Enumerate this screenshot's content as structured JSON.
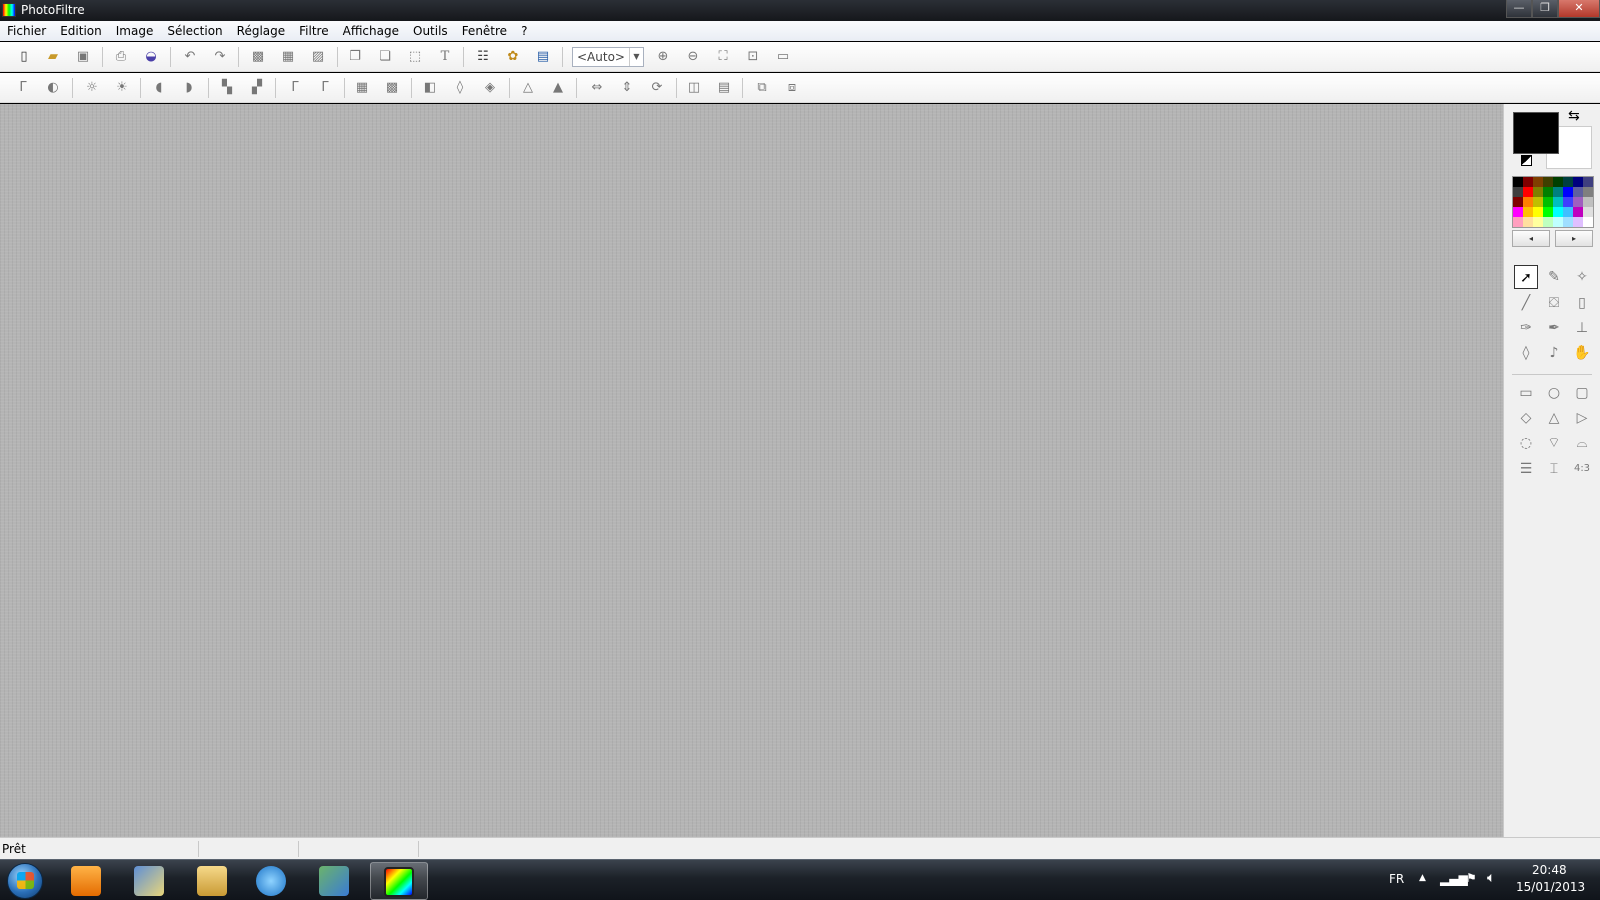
{
  "window": {
    "title": "PhotoFiltre",
    "minimize_glyph": "—",
    "maximize_glyph": "❐",
    "close_glyph": "✕"
  },
  "menu": {
    "items": [
      "Fichier",
      "Edition",
      "Image",
      "Sélection",
      "Réglage",
      "Filtre",
      "Affichage",
      "Outils",
      "Fenêtre",
      "?"
    ]
  },
  "toolbar": {
    "zoom_value": "<Auto>",
    "icons_row1": [
      "new-icon",
      "open-icon",
      "save-icon",
      "print-icon",
      "scan-icon",
      "undo-icon",
      "redo-icon",
      "fill-icon",
      "pattern-icon",
      "clear-icon",
      "copy-icon",
      "paste-icon",
      "crop-icon",
      "text-icon",
      "explorer-icon",
      "plugin-icon",
      "window-icon",
      "zoom-in-icon",
      "zoom-out-icon",
      "fit-icon",
      "actual-size-icon",
      "fullscreen-icon"
    ],
    "icons_row2": [
      "auto-level-icon",
      "auto-contrast-icon",
      "brightness-minus-icon",
      "brightness-plus-icon",
      "contrast-minus-icon",
      "contrast-plus-icon",
      "saturation-minus-icon",
      "saturation-plus-icon",
      "gamma-minus-icon",
      "gamma-plus-icon",
      "grayscale-icon",
      "sepia-icon",
      "invert-icon",
      "blur-icon",
      "blur-more-icon",
      "sharpen-icon",
      "sharpen-more-icon",
      "flip-horizontal-icon",
      "flip-vertical-icon",
      "rotate-icon",
      "image-size-icon",
      "canvas-size-icon",
      "transparency-icon",
      "mask-icon"
    ]
  },
  "colors": {
    "foreground": "#000000",
    "background": "#ffffff",
    "palette": [
      "#000000",
      "#7f0000",
      "#7f3f00",
      "#3f3f00",
      "#003f00",
      "#003f3f",
      "#00007f",
      "#3f3f7f",
      "#3f3f3f",
      "#ff0000",
      "#7f7f00",
      "#007f00",
      "#007f7f",
      "#0000ff",
      "#5f5f9f",
      "#7f7f7f",
      "#7f0000",
      "#ff7f00",
      "#bfbf00",
      "#00bf00",
      "#00bfbf",
      "#3f3fff",
      "#9f5fbf",
      "#bfbfbf",
      "#ff00ff",
      "#ffbf00",
      "#ffff00",
      "#00ff00",
      "#00ffff",
      "#3fbfff",
      "#bf00bf",
      "#dfdfdf",
      "#ff9fbf",
      "#ffdf9f",
      "#ffff9f",
      "#bfffbf",
      "#bfffff",
      "#9fdfff",
      "#dfbfff",
      "#ffffff"
    ],
    "prev_glyph": "◂",
    "next_glyph": "▸"
  },
  "tools": {
    "selection_tools": [
      "select-arrow-icon",
      "color-picker-icon",
      "magic-wand-icon",
      "line-icon",
      "fill-bucket-icon",
      "spray-icon",
      "brush-icon",
      "advanced-brush-icon",
      "clone-stamp-icon",
      "blur-drop-icon",
      "smudge-icon",
      "hand-icon"
    ],
    "shape_tools": [
      "rectangle-shape-icon",
      "ellipse-shape-icon",
      "rounded-rect-shape-icon",
      "diamond-shape-icon",
      "triangle-shape-icon",
      "arrow-shape-icon",
      "lasso-icon",
      "polygon-lasso-icon",
      "open-shape-icon",
      "selection-all-icon",
      "selection-text-icon",
      "selection-ratio-icon"
    ]
  },
  "status": {
    "text": "Prêt"
  },
  "taskbar": {
    "language": "FR",
    "time": "20:48",
    "date": "15/01/2013",
    "apps": [
      "media-player-icon",
      "photo-gallery-icon",
      "file-explorer-icon",
      "internet-explorer-icon",
      "network-users-icon",
      "photofiltre-icon"
    ]
  }
}
